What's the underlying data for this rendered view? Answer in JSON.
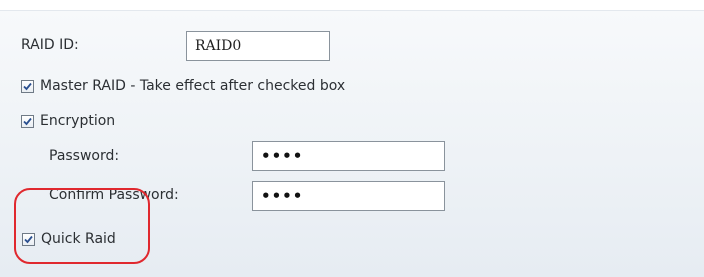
{
  "raid_id": {
    "label": "RAID ID:",
    "value": "RAID0"
  },
  "master_raid": {
    "label": "Master RAID - Take effect after checked box",
    "checked": true
  },
  "encryption": {
    "label": "Encryption",
    "checked": true
  },
  "password": {
    "label": "Password:",
    "value": "••••"
  },
  "confirm_password": {
    "label": "Confirm Password:",
    "value": "••••"
  },
  "quick_raid": {
    "label": "Quick Raid",
    "checked": true
  },
  "colors": {
    "highlight": "#e0282e",
    "check": "#2a4f8f"
  },
  "icons": {
    "checkbox": "checkmark-icon"
  }
}
